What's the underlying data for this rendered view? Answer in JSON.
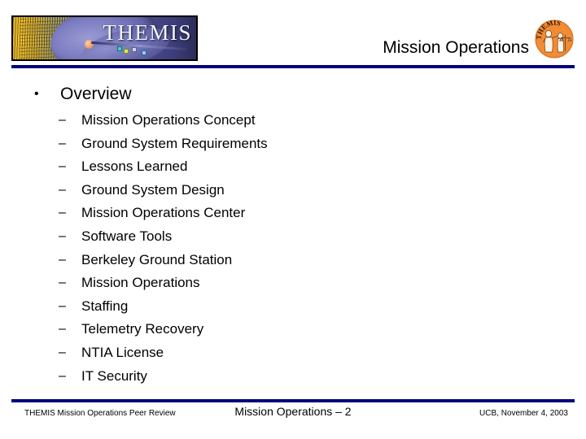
{
  "slide": {
    "title": "Mission Operations",
    "banner_wordmark": "THEMIS",
    "badge_text": "THEMIS"
  },
  "colors": {
    "rule_navy": "#000080",
    "badge_orange": "#F28B33",
    "banner_gold": "#D9A410",
    "banner_blue": "#5D5EA6"
  },
  "outline": {
    "level1_marker": "•",
    "level1_label": "Overview",
    "sub_marker": "–",
    "items": [
      {
        "label": "Mission Operations Concept"
      },
      {
        "label": "Ground System Requirements"
      },
      {
        "label": "Lessons Learned"
      },
      {
        "label": "Ground System Design"
      },
      {
        "label": "Mission Operations Center"
      },
      {
        "label": "Software Tools"
      },
      {
        "label": "Berkeley Ground Station"
      },
      {
        "label": "Mission Operations"
      },
      {
        "label": "Staffing"
      },
      {
        "label": "Telemetry Recovery"
      },
      {
        "label": "NTIA License"
      },
      {
        "label": "IT Security"
      }
    ]
  },
  "footer": {
    "left": "THEMIS Mission Operations Peer Review",
    "center": "Mission Operations – 2",
    "right": "UCB, November 4, 2003"
  }
}
